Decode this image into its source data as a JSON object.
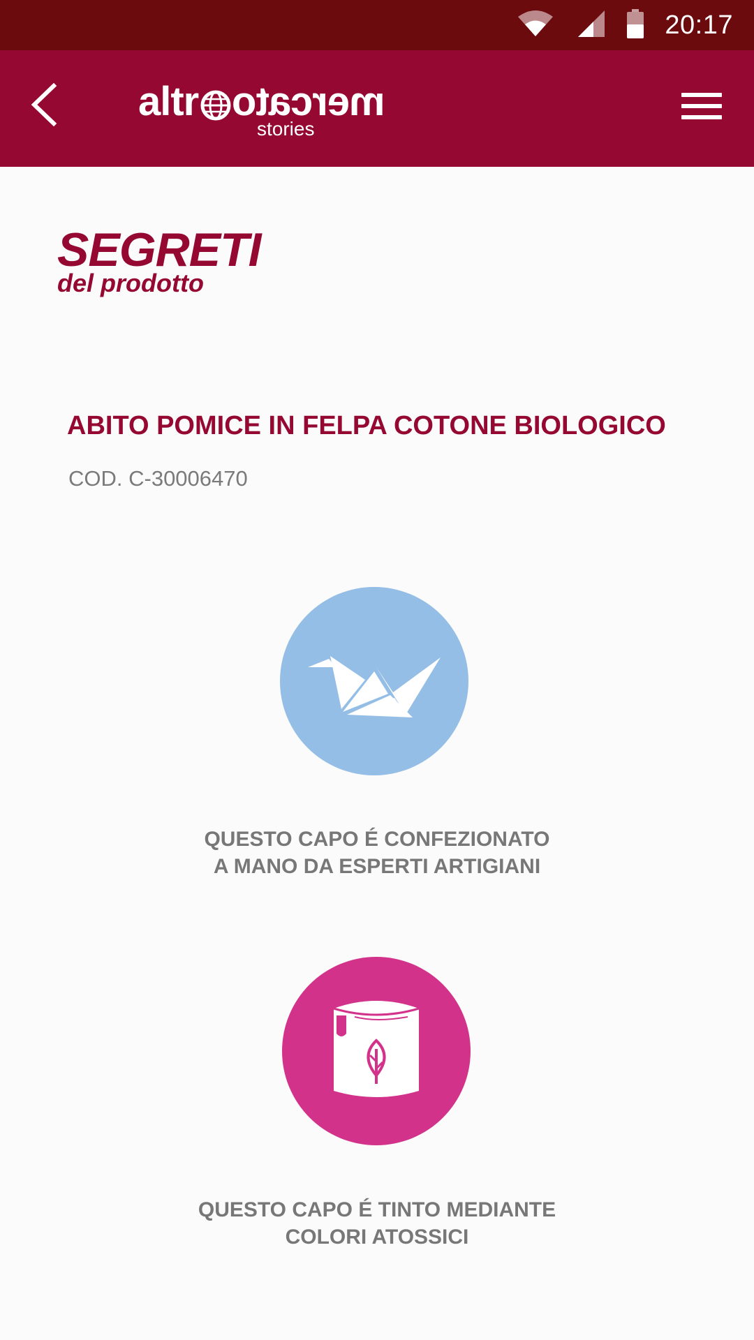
{
  "status_bar": {
    "time": "20:17",
    "icons": [
      "wifi-icon",
      "cell-signal-icon",
      "battery-icon"
    ]
  },
  "app_bar": {
    "logo_left": "altr",
    "logo_right": "mercato",
    "logo_sub": "stories",
    "back_icon": "chevron-left-icon",
    "menu_icon": "hamburger-menu-icon",
    "color": "#950832"
  },
  "section": {
    "title": "SEGRETI",
    "subtitle": "del prodotto"
  },
  "product": {
    "name": "ABITO POMICE IN FELPA COTONE BIOLOGICO",
    "code": "COD. C-30006470"
  },
  "features": [
    {
      "icon": "origami-crane-icon",
      "color": "#94bee6",
      "line1": "QUESTO CAPO É CONFEZIONATO",
      "line2": "A MANO DA ESPERTI ARTIGIANI"
    },
    {
      "icon": "paint-can-leaf-icon",
      "color": "#d3328b",
      "line1": "QUESTO CAPO É TINTO MEDIANTE",
      "line2": "COLORI ATOSSICI"
    }
  ]
}
